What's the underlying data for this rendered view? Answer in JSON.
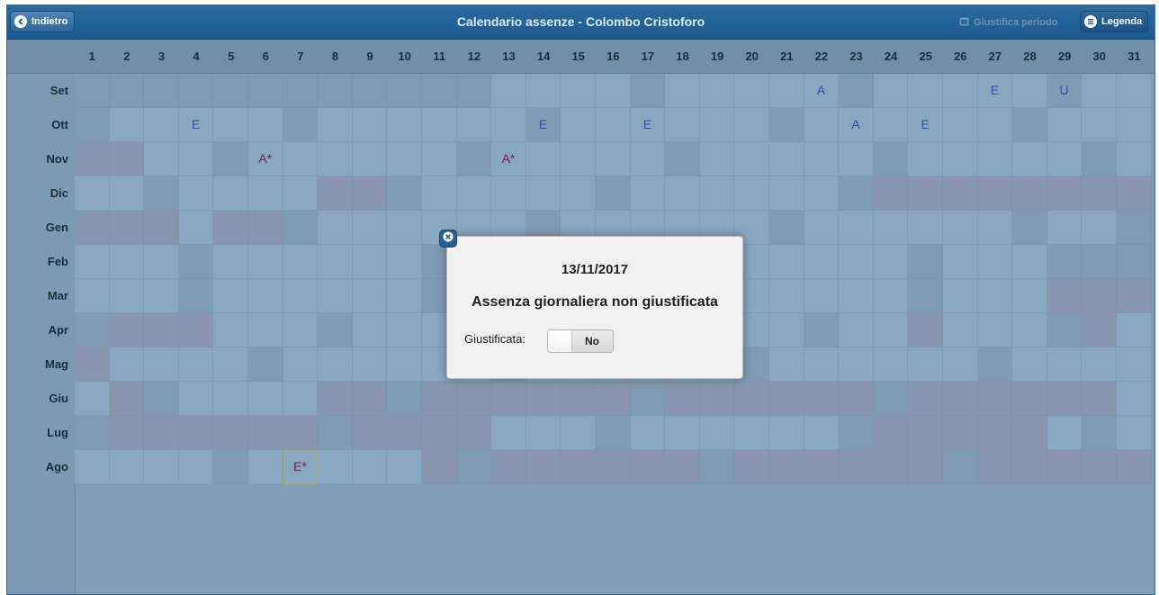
{
  "header": {
    "back_label": "Indietro",
    "title": "Calendario assenze - Colombo Cristoforo",
    "justify_label": "Giustifica periodo",
    "legend_label": "Legenda"
  },
  "days": [
    "1",
    "2",
    "3",
    "4",
    "5",
    "6",
    "7",
    "8",
    "9",
    "10",
    "11",
    "12",
    "13",
    "14",
    "15",
    "16",
    "17",
    "18",
    "19",
    "20",
    "21",
    "22",
    "23",
    "24",
    "25",
    "26",
    "27",
    "28",
    "29",
    "30",
    "31"
  ],
  "months": [
    {
      "label": "Set",
      "pattern": "eeeeeeeeeeeewwwwhwwwwwhwwwwwhww",
      "marks": {
        "22": "A",
        "27": "E",
        "29": "U"
      }
    },
    {
      "label": "Ott",
      "pattern": "hwwwwwhwwwwwwhwwwwwwhwwwwwwhwww",
      "marks": {
        "4": "E",
        "14": "E",
        "17": "E",
        "23": "A",
        "25": "E"
      }
    },
    {
      "label": "Nov",
      "pattern": "vvwwhwwwwwwhwwwwwhwwwwwhwwwwwhw",
      "marks": {
        "6": "A*",
        "13": "A*"
      }
    },
    {
      "label": "Dic",
      "pattern": "wwhwwwwvvhwwwwwhwwwwwwhvvvvvvvv",
      "marks": {}
    },
    {
      "label": "Gen",
      "pattern": "vvvwvvhwwwwwwhwwwwwwhwwwwwwhwwe",
      "marks": {}
    },
    {
      "label": "Feb",
      "pattern": "wwwhwwwwwwhwwwwwwhwwwwwwhwwweee",
      "marks": {}
    },
    {
      "label": "Mar",
      "pattern": "wwwhwwwwwwhwwwwwwhwwwwwwhwwwvvv",
      "marks": {}
    },
    {
      "label": "Apr",
      "pattern": "hvvvwwwhwwwwwwhwwwwwwhwwvwwwhvw",
      "marks": {}
    },
    {
      "label": "Mag",
      "pattern": "vwwwwhwwwwwwhwwwwwwhwwwwwwhwwww",
      "marks": {}
    },
    {
      "label": "Giu",
      "pattern": "wvhwwwwvvhvvvvvvhvvvvvvhvvvvvvw",
      "marks": {}
    },
    {
      "label": "Lug",
      "pattern": "hvvvvvvhvvvvwwwhwwwwwwhvvvvvwhw",
      "marks": {}
    },
    {
      "label": "Ago",
      "pattern": "wwwwhwwwwwvhvvvvvvhvvvvvvhvvvvv",
      "marks": {
        "7": "E*"
      },
      "selected": "7"
    }
  ],
  "modal": {
    "date": "13/11/2017",
    "message": "Assenza giornaliera non giustificata",
    "field_label": "Giustificata:",
    "toggle_value": "No"
  },
  "colors": {
    "header": "#1e5a8d",
    "workday": "#87a6c0",
    "holiday": "#809cb5",
    "vacation": "#8996b0",
    "mark_blue": "#2d53a8",
    "mark_red": "#7a2348"
  }
}
